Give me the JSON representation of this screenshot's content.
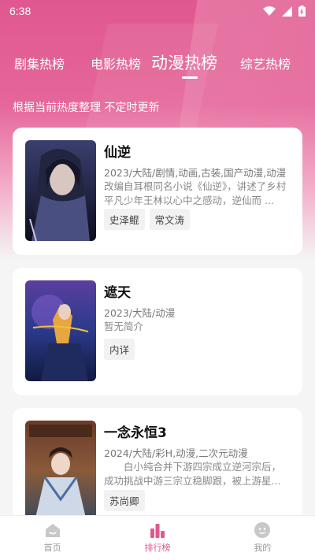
{
  "status_bar": {
    "time": "6:38",
    "icons": [
      "wifi-icon",
      "signal-icon",
      "battery-icon"
    ]
  },
  "tabs": [
    {
      "label": "剧集热榜",
      "active": false
    },
    {
      "label": "电影热榜",
      "active": false
    },
    {
      "label": "动漫热榜",
      "active": true
    },
    {
      "label": "综艺热榜",
      "active": false
    }
  ],
  "subtitle": "根据当前热度整理 不定时更新",
  "items": [
    {
      "title": "仙逆",
      "meta": "2023/大陆/剧情,动画,古装,国产动漫,动漫",
      "desc": "改编自耳根同名小说《仙逆》，讲述了乡村平凡少年王林以心中之感动，逆仙而 ...",
      "tags": [
        "史泽鲲",
        "常文涛"
      ]
    },
    {
      "title": "遮天",
      "meta": "2023/大陆/动漫",
      "desc": "暂无简介",
      "tags": [
        "内详"
      ]
    },
    {
      "title": "一念永恒3",
      "meta": "2024/大陆/彩H,动漫,二次元动漫",
      "desc": "白小纯合并下游四宗成立逆河宗后，成功挑战中游三宗立稳脚跟，被上游星...",
      "tags": [
        "苏尚卿"
      ]
    }
  ],
  "bottom_nav": [
    {
      "label": "首页",
      "icon": "home-icon",
      "active": false
    },
    {
      "label": "排行榜",
      "icon": "ranking-icon",
      "active": true
    },
    {
      "label": "我的",
      "icon": "profile-icon",
      "active": false
    }
  ],
  "colors": {
    "accent": "#e0588f",
    "header_bg": "#e5669a",
    "page_bg": "#f5f5f5"
  }
}
